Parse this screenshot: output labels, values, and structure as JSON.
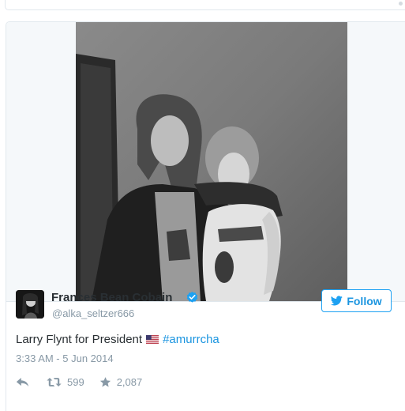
{
  "tweet": {
    "author": {
      "name": "Frances Bean Cobain",
      "handle": "@alka_seltzer666",
      "verified": true
    },
    "follow_button": {
      "label": "Follow",
      "icon": "twitter-bird-icon",
      "color": "#1b95e0"
    },
    "text_before_flag": "Larry Flynt for President",
    "flag_icon": "us-flag-icon",
    "hashtag": "#amurrcha",
    "timestamp": "3:33 AM - 5 Jun 2014",
    "actions": {
      "reply_icon": "reply-icon",
      "retweet_icon": "retweet-icon",
      "retweet_count": "599",
      "favorite_icon": "star-icon",
      "favorite_count": "2,087"
    },
    "media": {
      "type": "photo",
      "style": "black-and-white"
    }
  },
  "colors": {
    "link": "#1b95e0",
    "text": "#292f33",
    "muted": "#8899a6",
    "border": "#e1e8ed",
    "verified": "#1da1f2"
  }
}
